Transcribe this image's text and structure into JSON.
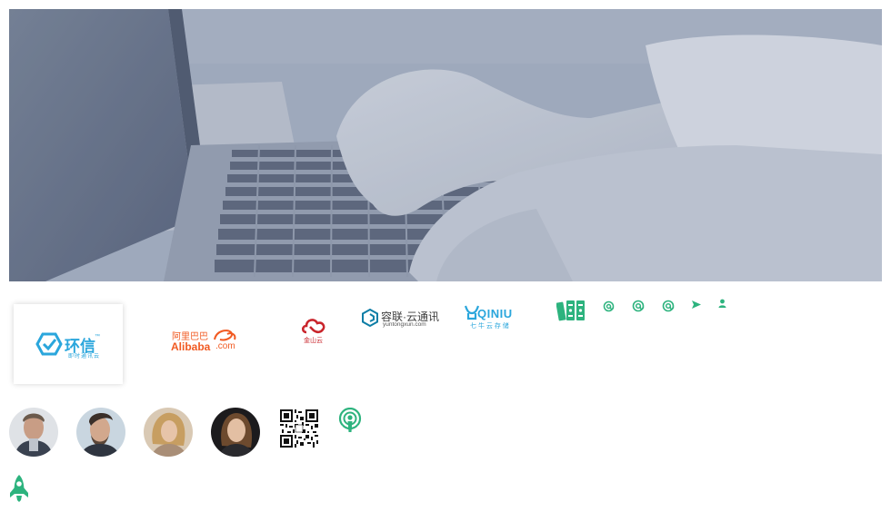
{
  "banner": {
    "alt": "laptop-typing-hero"
  },
  "partners": {
    "huanxin": {
      "name": "环信",
      "tagline": "即时通讯云",
      "tm": "™"
    },
    "alibaba": {
      "cn": "阿里巴巴",
      "en": "Alibaba",
      "suffix": ".com"
    },
    "kingsoft": {
      "name": "金山云"
    },
    "ronglian": {
      "name": "容联·云通讯",
      "domain": "yuntongxun.com"
    },
    "qiniu": {
      "name": "QINIU",
      "cn": "七 牛 云 存 储"
    }
  },
  "colors": {
    "green": "#2db37e",
    "blue": "#2aa6dc",
    "orange": "#f15a22",
    "red": "#c9252c",
    "teal": "#0e7ea6"
  },
  "icons": [
    "books-icon",
    "at-icon-1",
    "at-icon-2",
    "at-icon-3",
    "send-icon",
    "user-icon",
    "podcast-icon",
    "rocket-icon",
    "qr-code-icon"
  ]
}
